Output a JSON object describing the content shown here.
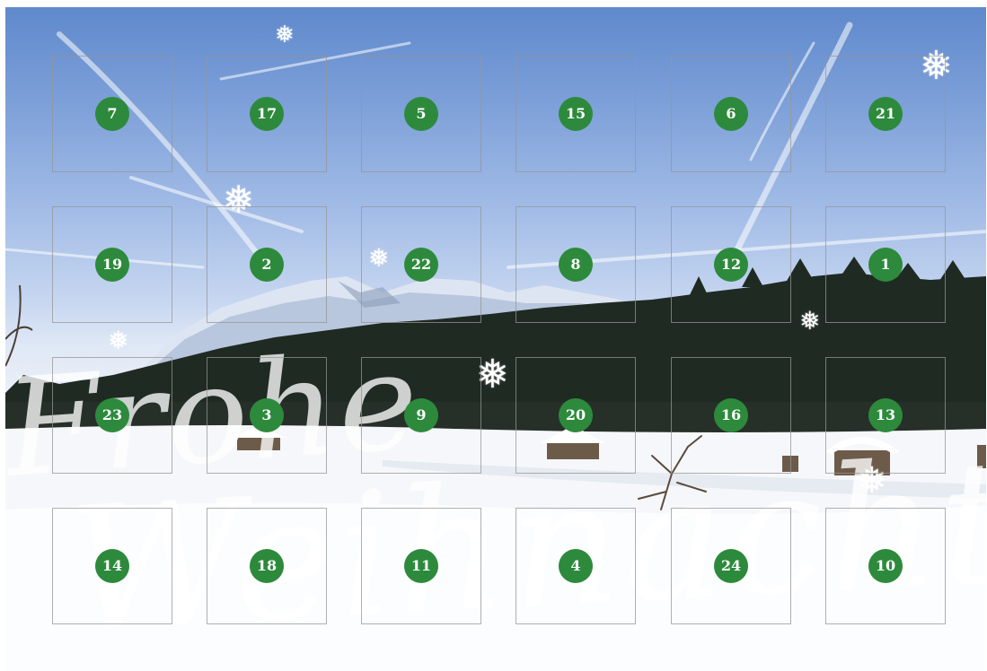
{
  "greeting": {
    "line1": "Frohe",
    "line2": "Weihnachten"
  },
  "colors": {
    "door_number_bg": "#2d8a3c",
    "door_number_text": "#ffffff",
    "door_border": "#969696",
    "sky_top": "#5f89cc",
    "snow": "#f7f8fa"
  },
  "doors": [
    {
      "number": "7"
    },
    {
      "number": "17"
    },
    {
      "number": "5"
    },
    {
      "number": "15"
    },
    {
      "number": "6"
    },
    {
      "number": "21"
    },
    {
      "number": "19"
    },
    {
      "number": "2"
    },
    {
      "number": "22"
    },
    {
      "number": "8"
    },
    {
      "number": "12"
    },
    {
      "number": "1"
    },
    {
      "number": "23"
    },
    {
      "number": "3"
    },
    {
      "number": "9"
    },
    {
      "number": "20"
    },
    {
      "number": "16"
    },
    {
      "number": "13"
    },
    {
      "number": "14"
    },
    {
      "number": "18"
    },
    {
      "number": "11"
    },
    {
      "number": "4"
    },
    {
      "number": "24"
    },
    {
      "number": "10"
    }
  ],
  "decorations": {
    "snowflake_icon": "❅"
  }
}
